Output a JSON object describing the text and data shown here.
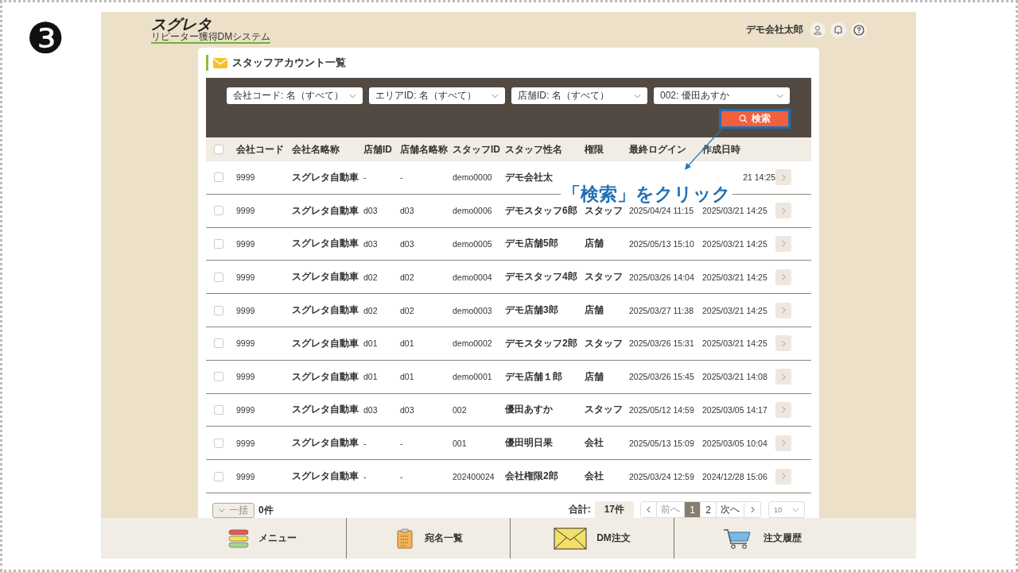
{
  "slide": {
    "step": "❸",
    "callout": "「検索」をクリック"
  },
  "app": {
    "logo": "スグレタ",
    "logo_subtitle": "リピーター獲得DMシステム",
    "user_name": "デモ会社太郎"
  },
  "page_title": "スタッフアカウント一覧",
  "filters": [
    {
      "value": "会社コード: 名（すべて）"
    },
    {
      "value": "エリアID: 名（すべて）"
    },
    {
      "value": "店舗ID: 名（すべて）"
    },
    {
      "value": "002: 優田あすか"
    }
  ],
  "search_button": {
    "label": "検索",
    "highlighted": true
  },
  "table": {
    "header_checked": false,
    "columns": [
      "会社コード",
      "会社名略称",
      "店舗ID",
      "店舗名略称",
      "スタッフID",
      "スタッフ性名",
      "権限",
      "最終ログイン",
      "作成日時"
    ],
    "rows": [
      {
        "checked": false,
        "company_code": "9999",
        "company_name": "スグレタ自動車",
        "store_id": "-",
        "store_name": "-",
        "staff_id": "demo0000",
        "staff_name": "デモ会社太",
        "created": "21 14:25"
      },
      {
        "checked": false,
        "company_code": "9999",
        "company_name": "スグレタ自動車",
        "store_id": "d03",
        "store_name": "d03",
        "staff_id": "demo0006",
        "staff_name": "デモスタッフ6郎",
        "role": "スタッフ",
        "last_login": "2025/04/24 11:15",
        "created": "2025/03/21 14:25"
      },
      {
        "checked": false,
        "company_code": "9999",
        "company_name": "スグレタ自動車",
        "store_id": "d03",
        "store_name": "d03",
        "staff_id": "demo0005",
        "staff_name": "デモ店舗5郎",
        "role": "店舗",
        "last_login": "2025/05/13 15:10",
        "created": "2025/03/21 14:25"
      },
      {
        "checked": false,
        "company_code": "9999",
        "company_name": "スグレタ自動車",
        "store_id": "d02",
        "store_name": "d02",
        "staff_id": "demo0004",
        "staff_name": "デモスタッフ4郎",
        "role": "スタッフ",
        "last_login": "2025/03/26 14:04",
        "created": "2025/03/21 14:25"
      },
      {
        "checked": false,
        "company_code": "9999",
        "company_name": "スグレタ自動車",
        "store_id": "d02",
        "store_name": "d02",
        "staff_id": "demo0003",
        "staff_name": "デモ店舗3郎",
        "role": "店舗",
        "last_login": "2025/03/27 11:38",
        "created": "2025/03/21 14:25"
      },
      {
        "checked": false,
        "company_code": "9999",
        "company_name": "スグレタ自動車",
        "store_id": "d01",
        "store_name": "d01",
        "staff_id": "demo0002",
        "staff_name": "デモスタッフ2郎",
        "role": "スタッフ",
        "last_login": "2025/03/26 15:31",
        "created": "2025/03/21 14:25"
      },
      {
        "checked": false,
        "company_code": "9999",
        "company_name": "スグレタ自動車",
        "store_id": "d01",
        "store_name": "d01",
        "staff_id": "demo0001",
        "staff_name": "デモ店舗１郎",
        "role": "店舗",
        "last_login": "2025/03/26 15:45",
        "created": "2025/03/21 14:08"
      },
      {
        "checked": false,
        "company_code": "9999",
        "company_name": "スグレタ自動車",
        "store_id": "d03",
        "store_name": "d03",
        "staff_id": "002",
        "staff_name": "優田あすか",
        "role": "スタッフ",
        "last_login": "2025/05/12 14:59",
        "created": "2025/03/05 14:17"
      },
      {
        "checked": false,
        "company_code": "9999",
        "company_name": "スグレタ自動車",
        "store_id": "-",
        "store_name": "-",
        "staff_id": "001",
        "staff_name": "優田明日果",
        "role": "会社",
        "last_login": "2025/05/13 15:09",
        "created": "2025/03/05 10:04"
      },
      {
        "checked": false,
        "company_code": "9999",
        "company_name": "スグレタ自動車",
        "store_id": "-",
        "store_name": "-",
        "staff_id": "202400024",
        "staff_name": "会社権限2郎",
        "role": "会社",
        "last_login": "2025/03/24 12:59",
        "created": "2024/12/28 15:06"
      }
    ]
  },
  "bulk": {
    "label": "一括",
    "count": "0件"
  },
  "pagination": {
    "total_label": "合計:",
    "total": "17件",
    "prev": "前へ",
    "next": "次へ",
    "pages": [
      {
        "label": "1",
        "selected": true
      },
      {
        "label": "2",
        "selected": false
      }
    ],
    "page_size": "10"
  },
  "bottom_nav": [
    {
      "label": "メニュー",
      "kind": "menu"
    },
    {
      "label": "宛名一覧",
      "kind": "clipboard"
    },
    {
      "label": "DM注文",
      "kind": "envelope"
    },
    {
      "label": "注文履歴",
      "kind": "cart"
    }
  ]
}
